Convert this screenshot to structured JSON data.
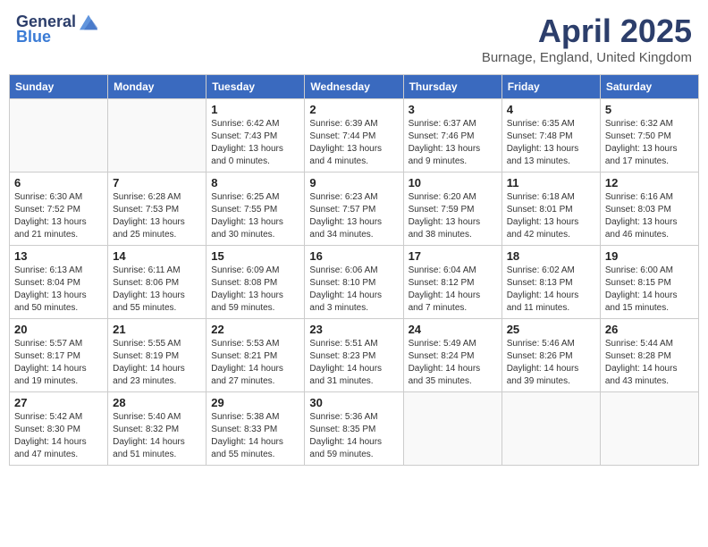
{
  "header": {
    "logo_general": "General",
    "logo_blue": "Blue",
    "month_title": "April 2025",
    "location": "Burnage, England, United Kingdom"
  },
  "weekdays": [
    "Sunday",
    "Monday",
    "Tuesday",
    "Wednesday",
    "Thursday",
    "Friday",
    "Saturday"
  ],
  "weeks": [
    [
      {
        "day": "",
        "info": ""
      },
      {
        "day": "",
        "info": ""
      },
      {
        "day": "1",
        "info": "Sunrise: 6:42 AM\nSunset: 7:43 PM\nDaylight: 13 hours and 0 minutes."
      },
      {
        "day": "2",
        "info": "Sunrise: 6:39 AM\nSunset: 7:44 PM\nDaylight: 13 hours and 4 minutes."
      },
      {
        "day": "3",
        "info": "Sunrise: 6:37 AM\nSunset: 7:46 PM\nDaylight: 13 hours and 9 minutes."
      },
      {
        "day": "4",
        "info": "Sunrise: 6:35 AM\nSunset: 7:48 PM\nDaylight: 13 hours and 13 minutes."
      },
      {
        "day": "5",
        "info": "Sunrise: 6:32 AM\nSunset: 7:50 PM\nDaylight: 13 hours and 17 minutes."
      }
    ],
    [
      {
        "day": "6",
        "info": "Sunrise: 6:30 AM\nSunset: 7:52 PM\nDaylight: 13 hours and 21 minutes."
      },
      {
        "day": "7",
        "info": "Sunrise: 6:28 AM\nSunset: 7:53 PM\nDaylight: 13 hours and 25 minutes."
      },
      {
        "day": "8",
        "info": "Sunrise: 6:25 AM\nSunset: 7:55 PM\nDaylight: 13 hours and 30 minutes."
      },
      {
        "day": "9",
        "info": "Sunrise: 6:23 AM\nSunset: 7:57 PM\nDaylight: 13 hours and 34 minutes."
      },
      {
        "day": "10",
        "info": "Sunrise: 6:20 AM\nSunset: 7:59 PM\nDaylight: 13 hours and 38 minutes."
      },
      {
        "day": "11",
        "info": "Sunrise: 6:18 AM\nSunset: 8:01 PM\nDaylight: 13 hours and 42 minutes."
      },
      {
        "day": "12",
        "info": "Sunrise: 6:16 AM\nSunset: 8:03 PM\nDaylight: 13 hours and 46 minutes."
      }
    ],
    [
      {
        "day": "13",
        "info": "Sunrise: 6:13 AM\nSunset: 8:04 PM\nDaylight: 13 hours and 50 minutes."
      },
      {
        "day": "14",
        "info": "Sunrise: 6:11 AM\nSunset: 8:06 PM\nDaylight: 13 hours and 55 minutes."
      },
      {
        "day": "15",
        "info": "Sunrise: 6:09 AM\nSunset: 8:08 PM\nDaylight: 13 hours and 59 minutes."
      },
      {
        "day": "16",
        "info": "Sunrise: 6:06 AM\nSunset: 8:10 PM\nDaylight: 14 hours and 3 minutes."
      },
      {
        "day": "17",
        "info": "Sunrise: 6:04 AM\nSunset: 8:12 PM\nDaylight: 14 hours and 7 minutes."
      },
      {
        "day": "18",
        "info": "Sunrise: 6:02 AM\nSunset: 8:13 PM\nDaylight: 14 hours and 11 minutes."
      },
      {
        "day": "19",
        "info": "Sunrise: 6:00 AM\nSunset: 8:15 PM\nDaylight: 14 hours and 15 minutes."
      }
    ],
    [
      {
        "day": "20",
        "info": "Sunrise: 5:57 AM\nSunset: 8:17 PM\nDaylight: 14 hours and 19 minutes."
      },
      {
        "day": "21",
        "info": "Sunrise: 5:55 AM\nSunset: 8:19 PM\nDaylight: 14 hours and 23 minutes."
      },
      {
        "day": "22",
        "info": "Sunrise: 5:53 AM\nSunset: 8:21 PM\nDaylight: 14 hours and 27 minutes."
      },
      {
        "day": "23",
        "info": "Sunrise: 5:51 AM\nSunset: 8:23 PM\nDaylight: 14 hours and 31 minutes."
      },
      {
        "day": "24",
        "info": "Sunrise: 5:49 AM\nSunset: 8:24 PM\nDaylight: 14 hours and 35 minutes."
      },
      {
        "day": "25",
        "info": "Sunrise: 5:46 AM\nSunset: 8:26 PM\nDaylight: 14 hours and 39 minutes."
      },
      {
        "day": "26",
        "info": "Sunrise: 5:44 AM\nSunset: 8:28 PM\nDaylight: 14 hours and 43 minutes."
      }
    ],
    [
      {
        "day": "27",
        "info": "Sunrise: 5:42 AM\nSunset: 8:30 PM\nDaylight: 14 hours and 47 minutes."
      },
      {
        "day": "28",
        "info": "Sunrise: 5:40 AM\nSunset: 8:32 PM\nDaylight: 14 hours and 51 minutes."
      },
      {
        "day": "29",
        "info": "Sunrise: 5:38 AM\nSunset: 8:33 PM\nDaylight: 14 hours and 55 minutes."
      },
      {
        "day": "30",
        "info": "Sunrise: 5:36 AM\nSunset: 8:35 PM\nDaylight: 14 hours and 59 minutes."
      },
      {
        "day": "",
        "info": ""
      },
      {
        "day": "",
        "info": ""
      },
      {
        "day": "",
        "info": ""
      }
    ]
  ]
}
